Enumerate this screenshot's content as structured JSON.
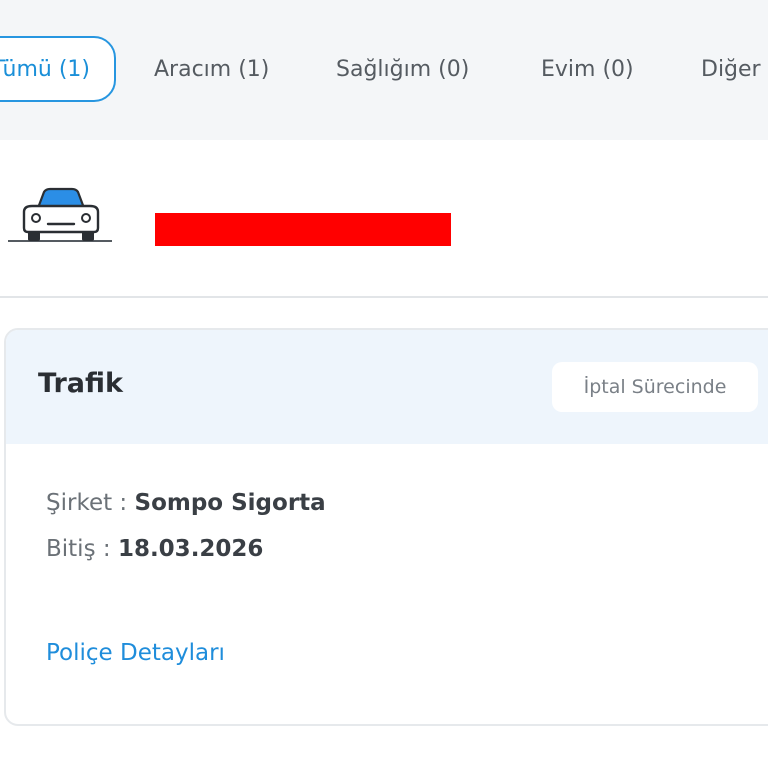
{
  "tabs": [
    {
      "label": "Tümü (1)",
      "active": true
    },
    {
      "label": "Aracım (1)",
      "active": false
    },
    {
      "label": "Sağlığım (0)",
      "active": false
    },
    {
      "label": "Evim (0)",
      "active": false
    },
    {
      "label": "Diğer",
      "active": false
    }
  ],
  "vehicle": {
    "icon": "car-icon"
  },
  "policy": {
    "title": "Trafik",
    "status": "İptal Sürecinde",
    "company_label": "Şirket : ",
    "company_value": "Sompo Sigorta",
    "end_label": "Bitiş : ",
    "end_value": "18.03.2026",
    "details_link": "Poliçe Detayları"
  },
  "colors": {
    "accent": "#1f8ddb",
    "redaction": "#ff0000",
    "header_bg": "#eef5fc"
  }
}
